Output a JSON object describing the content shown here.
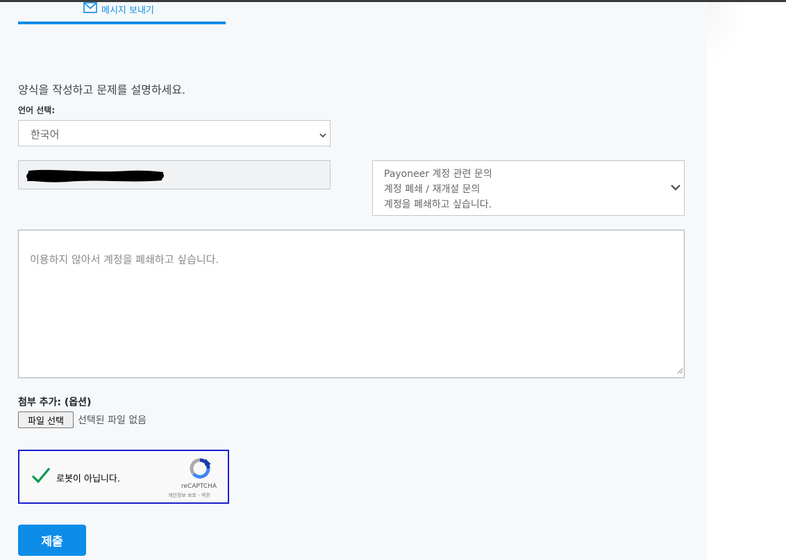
{
  "tab": {
    "label": "메시지 보내기",
    "icon": "envelope-icon"
  },
  "form": {
    "intro": "양식을 작성하고 문제를 설명하세요.",
    "language_label": "언어 선택:",
    "language_value": "한국어",
    "topic_lines": [
      "Payoneer 계정 관련 문의",
      "계정 폐쇄 / 재개설 문의",
      "계정을 폐쇄하고 싶습니다."
    ],
    "message_placeholder": "이용하지 않아서 계정을 폐쇄하고 싶습니다.",
    "attach_label": "첨부 추가: (옵션)",
    "file_button": "파일 선택",
    "file_status": "선택된 파일 없음",
    "submit_label": "제출"
  },
  "captcha": {
    "label": "로봇이 아닙니다.",
    "brand": "reCAPTCHA",
    "terms": "개인정보 보호 - 약관",
    "checked": true
  },
  "colors": {
    "accent": "#0d8de8",
    "panel_bg": "#f6f9fc",
    "captcha_border": "#1a1fd0",
    "check": "#009a4e"
  }
}
